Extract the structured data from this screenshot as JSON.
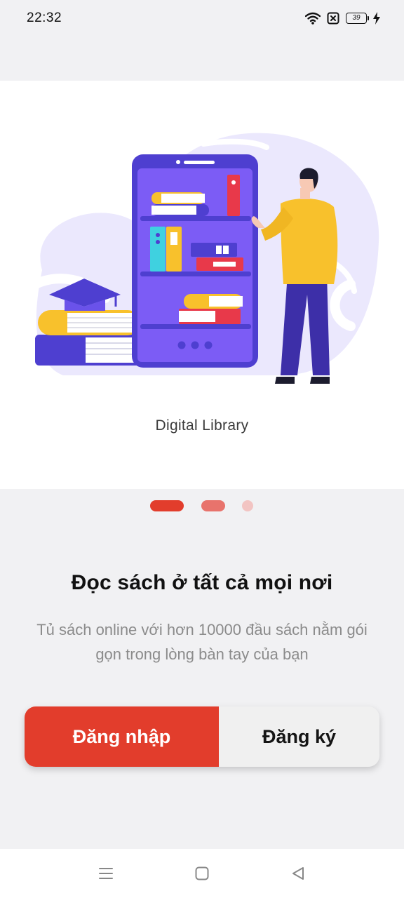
{
  "status_bar": {
    "time": "22:32",
    "battery_level": "39",
    "icons": [
      "wifi-icon",
      "sim-off-icon",
      "battery-icon",
      "charging-bolt-icon"
    ]
  },
  "hero": {
    "caption": "Digital Library"
  },
  "pager": {
    "page_count": 3,
    "active_index": 0
  },
  "content": {
    "headline": "Đọc sách ở tất cả mọi nơi",
    "subtext": "Tủ sách online với hơn 10000 đầu sách nằm gói gọn trong lòng bàn tay của bạn"
  },
  "buttons": {
    "login_label": "Đăng nhập",
    "register_label": "Đăng ký"
  },
  "nav_bar": {
    "icons": [
      "menu-icon",
      "home-icon",
      "back-icon"
    ]
  },
  "colors": {
    "accent": "#e23d2c",
    "illustration_purple": "#7c5cf5",
    "illustration_yellow": "#f8c12c"
  }
}
